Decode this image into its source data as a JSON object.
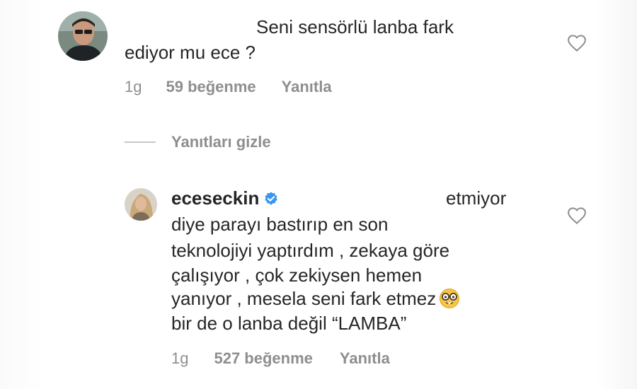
{
  "comment": {
    "text_line1": "Seni sensörlü lanba fark",
    "text_line2": "ediyor mu ece ?",
    "time": "1g",
    "likes": "59 beğenme",
    "reply_label": "Yanıtla"
  },
  "replies_toggle": {
    "label": "Yanıtları gizle"
  },
  "reply": {
    "username": "eceseckin",
    "line1_tail": "etmiyor",
    "lines": [
      "diye parayı bastırıp en son",
      "teknolojiyi yaptırdım , zekaya göre",
      "çalışıyor , çok zekiysen hemen",
      "yanıyor , mesela seni fark etmez",
      "bir de o lanba değil “LAMBA”"
    ],
    "time": "1g",
    "likes": "527 beğenme",
    "reply_label": "Yanıtla"
  },
  "icons": {
    "like": "heart-outline-icon",
    "verified": "verified-badge-icon",
    "emoji": "nerd-face-emoji-icon"
  },
  "colors": {
    "text": "#262626",
    "meta": "#8e8e8e",
    "verified": "#3897f0"
  }
}
